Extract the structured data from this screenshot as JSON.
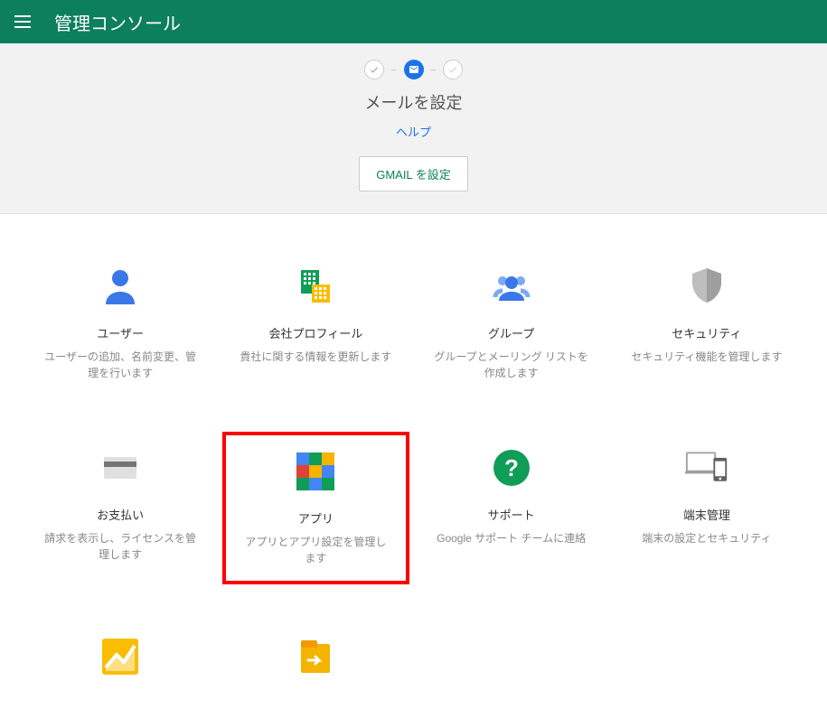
{
  "header": {
    "title": "管理コンソール"
  },
  "banner": {
    "title": "メールを設定",
    "help_label": "ヘルプ",
    "button_label": "GMAIL を設定"
  },
  "tiles": [
    {
      "title": "ユーザー",
      "desc": "ユーザーの追加、名前変更、管理を行います"
    },
    {
      "title": "会社プロフィール",
      "desc": "貴社に関する情報を更新します"
    },
    {
      "title": "グループ",
      "desc": "グループとメーリング リストを作成します"
    },
    {
      "title": "セキュリティ",
      "desc": "セキュリティ機能を管理します"
    },
    {
      "title": "お支払い",
      "desc": "請求を表示し、ライセンスを管理します"
    },
    {
      "title": "アプリ",
      "desc": "アプリとアプリ設定を管理します"
    },
    {
      "title": "サポート",
      "desc": "Google サポート チームに連絡"
    },
    {
      "title": "端末管理",
      "desc": "端末の設定とセキュリティ"
    },
    {
      "title": "",
      "desc": ""
    },
    {
      "title": "",
      "desc": ""
    }
  ]
}
